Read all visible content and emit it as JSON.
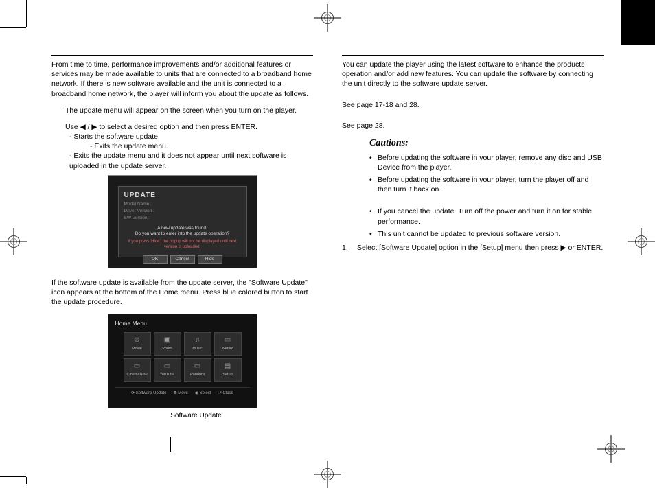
{
  "left": {
    "intro": "From time to time, performance improvements and/or additional features or services may be made available to units that are connected to a broadband home network. If there is new software available and the unit is connected to a broadband home network, the player will inform you about the update as follows.",
    "opt1_line": "The update menu will appear on the screen when you turn on the player.",
    "opt1_use": "Use ◀ / ▶ to select a desired option and then press ENTER.",
    "opt1_ok": "- Starts the software update.",
    "opt1_cancel": "- Exits the update menu.",
    "opt1_hide": "- Exits the update menu and it does not appear until next software is uploaded in the update server.",
    "panel1": {
      "title": "UPDATE",
      "l1": "Model Name : ",
      "l2": "Driver Version : ",
      "l3": "SW Version : ",
      "msg1": "A new update was found.",
      "msg2": "Do you want to enter into the update operation?",
      "warn": "If you press 'Hide', the popup will not be displayed until next version is uploaded.",
      "b1": "OK",
      "b2": "Cancel",
      "b3": "Hide"
    },
    "opt2_text": "If the software update is available from the update server, the \"Software Update\" icon appears at the bottom of the Home menu. Press blue colored button to start the update procedure.",
    "panel2": {
      "title": "Home Menu",
      "tiles": [
        "Movie",
        "Photo",
        "Music",
        "Netflix",
        "CinemaNow",
        "YouTube",
        "Pandora",
        "Setup"
      ],
      "footer": [
        "Software Update",
        "Move",
        "Select",
        "Close"
      ]
    },
    "caption2": "Software Update"
  },
  "right": {
    "intro": "You can update the player using the latest software to enhance the products operation and/or add new features. You can update the software by connecting the unit directly to the software update server.",
    "see1": "See page 17-18 and 28.",
    "see2": "See page 28.",
    "cautions_title": "Cautions:",
    "c1": "Before updating the software in your player, remove any disc and USB  Device from the player.",
    "c2": "Before updating the software in your player, turn the player off and then turn it back on.",
    "c3": "If you cancel the update. Turn off the power and turn it on for stable performance.",
    "c4": "This unit cannot be updated to previous software version.",
    "step1_num": "1.",
    "step1": "Select [Software Update] option in the [Setup] menu then press ▶ or ENTER."
  }
}
